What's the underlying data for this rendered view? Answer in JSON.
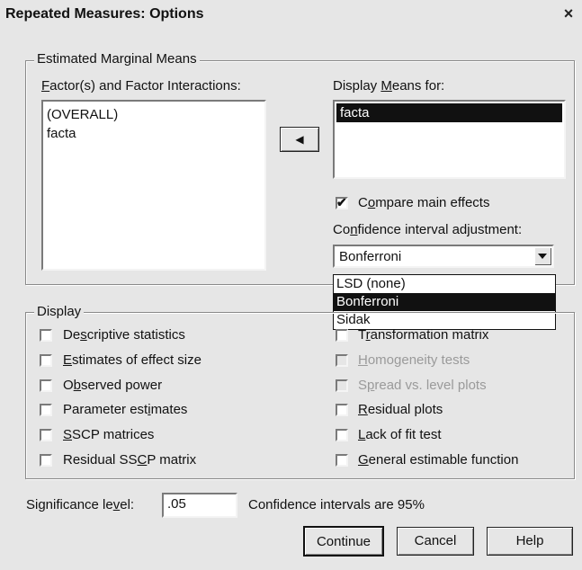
{
  "window": {
    "title": "Repeated Measures: Options",
    "close_glyph": "×"
  },
  "emm": {
    "group_title": "Estimated Marginal Means",
    "factors_label_pre": "",
    "factors_label_acc": "F",
    "factors_label_post": "actor(s) and Factor Interactions:",
    "factors_items": [
      "(OVERALL)",
      "facta"
    ],
    "move_glyph": "◀",
    "display_means_pre": "Display ",
    "display_means_acc": "M",
    "display_means_post": "eans for:",
    "display_means_items": [
      "facta"
    ],
    "compare_pre": "C",
    "compare_acc": "o",
    "compare_post": "mpare main effects",
    "compare_checked": true,
    "ci_adj_pre": "Co",
    "ci_adj_acc": "n",
    "ci_adj_post": "fidence interval adjustment:",
    "ci_adj_value": "Bonferroni",
    "ci_adj_options": [
      "LSD (none)",
      "Bonferroni",
      "Sidak"
    ],
    "ci_adj_selected": "Bonferroni"
  },
  "display": {
    "group_title": "Display",
    "left": [
      {
        "pre": "De",
        "acc": "s",
        "post": "criptive statistics",
        "checked": false,
        "enabled": true
      },
      {
        "pre": "",
        "acc": "E",
        "post": "stimates of effect size",
        "checked": false,
        "enabled": true
      },
      {
        "pre": "O",
        "acc": "b",
        "post": "served power",
        "checked": false,
        "enabled": true
      },
      {
        "pre": "Parameter est",
        "acc": "i",
        "post": "mates",
        "checked": false,
        "enabled": true
      },
      {
        "pre": "",
        "acc": "S",
        "post": "SCP matrices",
        "checked": false,
        "enabled": true
      },
      {
        "pre": "Residual SS",
        "acc": "C",
        "post": "P matrix",
        "checked": false,
        "enabled": true
      }
    ],
    "right": [
      {
        "pre": "T",
        "acc": "r",
        "post": "ansformation matrix",
        "checked": false,
        "enabled": true
      },
      {
        "pre": "",
        "acc": "H",
        "post": "omogeneity tests",
        "checked": false,
        "enabled": false
      },
      {
        "pre": "S",
        "acc": "p",
        "post": "read vs. level plots",
        "checked": false,
        "enabled": false
      },
      {
        "pre": "",
        "acc": "R",
        "post": "esidual plots",
        "checked": false,
        "enabled": true
      },
      {
        "pre": "",
        "acc": "L",
        "post": "ack of fit test",
        "checked": false,
        "enabled": true
      },
      {
        "pre": "",
        "acc": "G",
        "post": "eneral estimable function",
        "checked": false,
        "enabled": true
      }
    ]
  },
  "significance": {
    "label_pre": "Significance le",
    "label_acc": "v",
    "label_post": "el:",
    "value": ".05",
    "ci_text": "Confidence intervals are 95%"
  },
  "buttons": {
    "continue": "Continue",
    "cancel": "Cancel",
    "help": "Help"
  }
}
